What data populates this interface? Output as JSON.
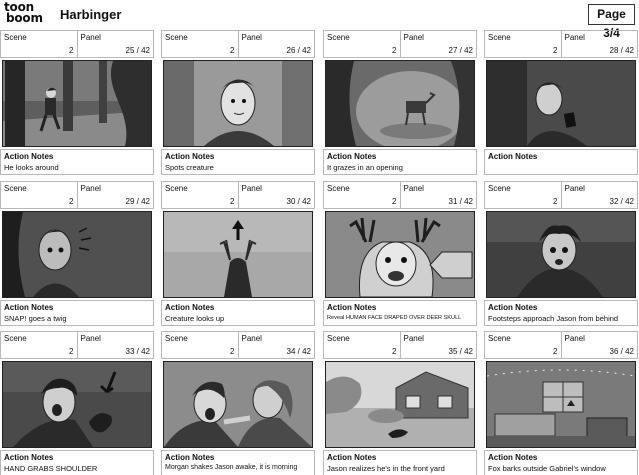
{
  "app": {
    "logo_top": "toon",
    "logo_bottom": "boom",
    "title": "Harbinger",
    "page": "Page 3/4"
  },
  "labels": {
    "scene": "Scene",
    "panel": "Panel",
    "action_notes": "Action Notes"
  },
  "panels": [
    {
      "scene": "2",
      "panel": "25 / 42",
      "note": "He looks around",
      "image": "forest-boy-running"
    },
    {
      "scene": "2",
      "panel": "26 / 42",
      "note": "Spots creature",
      "image": "boy-closeup-looking"
    },
    {
      "scene": "2",
      "panel": "27 / 42",
      "note": "It grazes in an opening",
      "image": "creature-grazing-clearing"
    },
    {
      "scene": "2",
      "panel": "28 / 42",
      "note": "",
      "image": "boy-holding-phone"
    },
    {
      "scene": "2",
      "panel": "29 / 42",
      "note": "SNAP! goes a twig",
      "image": "boy-startled-twig"
    },
    {
      "scene": "2",
      "panel": "30 / 42",
      "note": "Creature looks up",
      "image": "deer-looks-up-arrow"
    },
    {
      "scene": "2",
      "panel": "31 / 42",
      "note": "Reveal HUMAN FACE DRAPED OVER DEER SKULL",
      "image": "human-face-deer-skull"
    },
    {
      "scene": "2",
      "panel": "32 / 42",
      "note": "Footsteps approach Jason from behind",
      "image": "jason-frightened"
    },
    {
      "scene": "2",
      "panel": "33 / 42",
      "note": "HAND GRABS SHOULDER",
      "image": "hand-grabs-shoulder"
    },
    {
      "scene": "2",
      "panel": "34 / 42",
      "note": "Morgan shakes Jason awake, it is morning",
      "image": "morgan-shakes-jason"
    },
    {
      "scene": "2",
      "panel": "35 / 42",
      "note": "Jason realizes he's in the front yard",
      "image": "front-yard-house"
    },
    {
      "scene": "2",
      "panel": "36 / 42",
      "note": "Fox barks outside Gabriel's window",
      "image": "bedroom-window-fox"
    }
  ]
}
